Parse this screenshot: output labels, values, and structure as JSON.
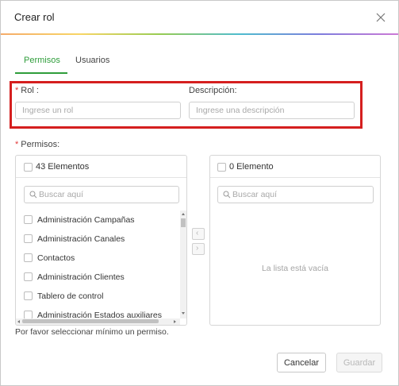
{
  "modal": {
    "title": "Crear rol",
    "close_icon": "close-icon"
  },
  "tabs": [
    {
      "label": "Permisos",
      "active": true
    },
    {
      "label": "Usuarios",
      "active": false
    }
  ],
  "form": {
    "rol": {
      "required_mark": "*",
      "label": "Rol",
      "placeholder": "Ingrese un rol",
      "value": ""
    },
    "descripcion": {
      "label": "Descripción",
      "placeholder": "Ingrese una descripción",
      "value": ""
    },
    "permisos": {
      "required_mark": "*",
      "label": "Permisos"
    }
  },
  "transfer": {
    "left": {
      "count_label": "43 Elementos",
      "search_placeholder": "Buscar aquí",
      "items": [
        "Administración Campañas",
        "Administración Canales",
        "Contactos",
        "Administración Clientes",
        "Tablero de control",
        "Administración Estados auxiliares"
      ]
    },
    "right": {
      "count_label": "0 Elemento",
      "search_placeholder": "Buscar aquí",
      "empty_text": "La lista está vacía"
    },
    "move_left_icon": "chevron-left-icon",
    "move_right_icon": "chevron-right-icon"
  },
  "hint": "Por favor seleccionar mínimo un permiso.",
  "buttons": {
    "cancel": "Cancelar",
    "save": "Guardar"
  },
  "colors": {
    "accent": "#2f9d3b",
    "required": "#e23a3a",
    "highlight_border": "#d51f1f"
  }
}
